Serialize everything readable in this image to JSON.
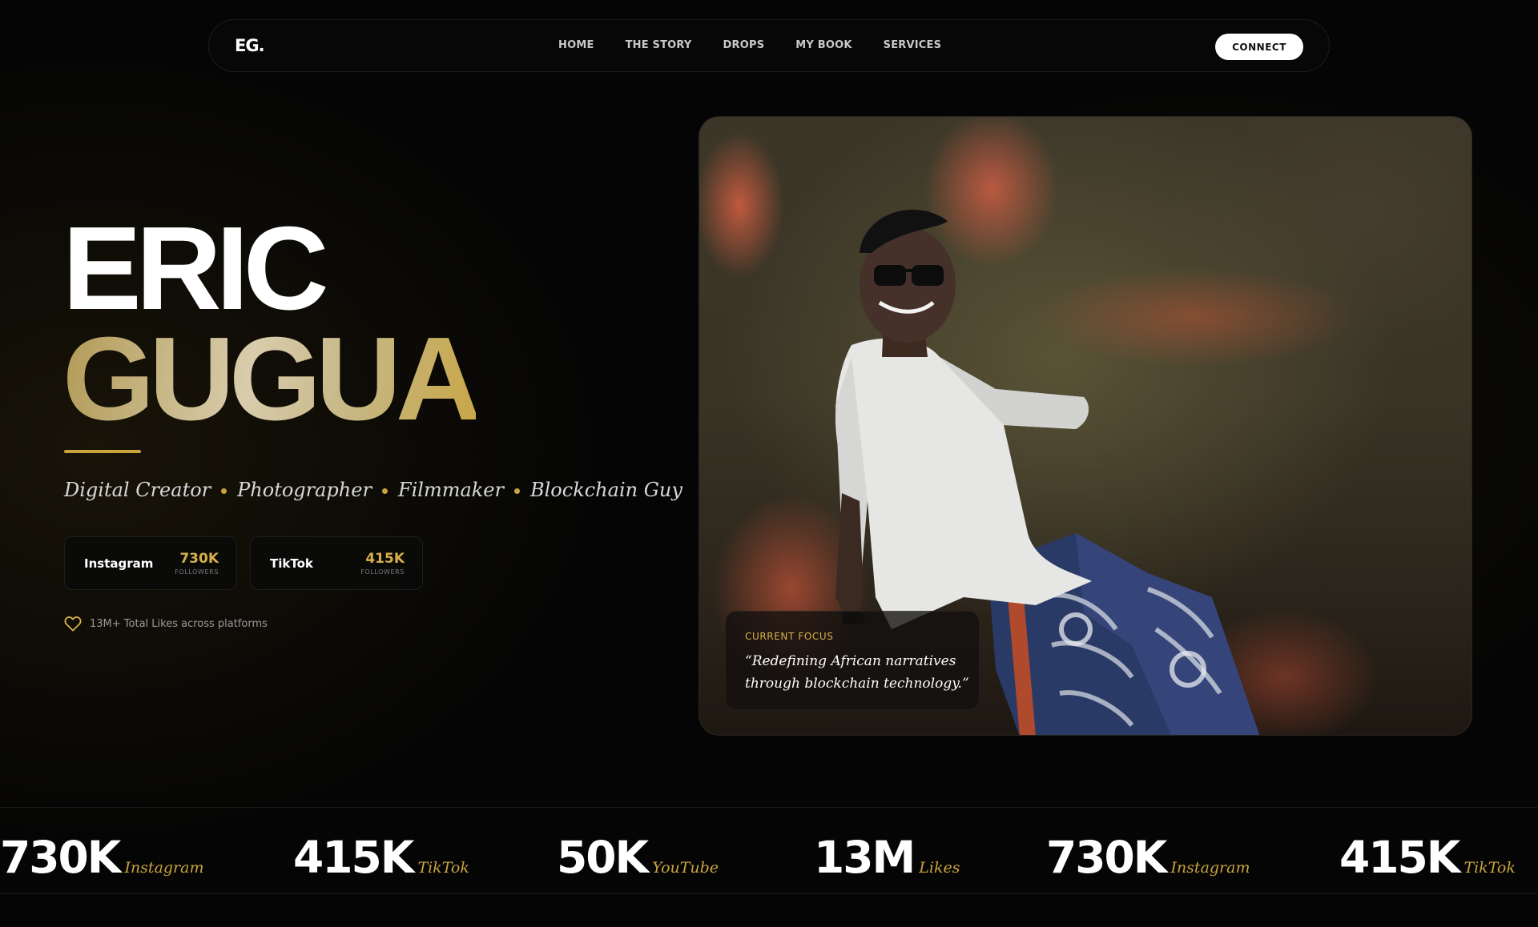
{
  "nav": {
    "logo": "EG.",
    "links": [
      "HOME",
      "THE STORY",
      "DROPS",
      "MY BOOK",
      "SERVICES"
    ],
    "cta": "CONNECT"
  },
  "hero": {
    "first_name": "ERIC",
    "last_name": "GUGUA",
    "roles": [
      "Digital Creator",
      "Photographer",
      "Filmmaker",
      "Blockchain Guy"
    ],
    "socials": [
      {
        "platform": "Instagram",
        "count": "730K",
        "sub": "FOLLOWERS"
      },
      {
        "platform": "TikTok",
        "count": "415K",
        "sub": "FOLLOWERS"
      }
    ],
    "likes_text": "13M+ Total Likes across platforms"
  },
  "photo": {
    "focus_label": "CURRENT FOCUS",
    "focus_quote": "“Redefining African narratives through blockchain technology.”"
  },
  "stats": [
    {
      "value": "730K",
      "label": "Instagram"
    },
    {
      "value": "415K",
      "label": "TikTok"
    },
    {
      "value": "50K",
      "label": "YouTube"
    },
    {
      "value": "13M",
      "label": "Likes"
    },
    {
      "value": "730K",
      "label": "Instagram"
    },
    {
      "value": "415K",
      "label": "TikTok"
    }
  ],
  "colors": {
    "accent_gold": "#c9a43d",
    "background": "#050505",
    "connect_button": "#ffffff"
  }
}
